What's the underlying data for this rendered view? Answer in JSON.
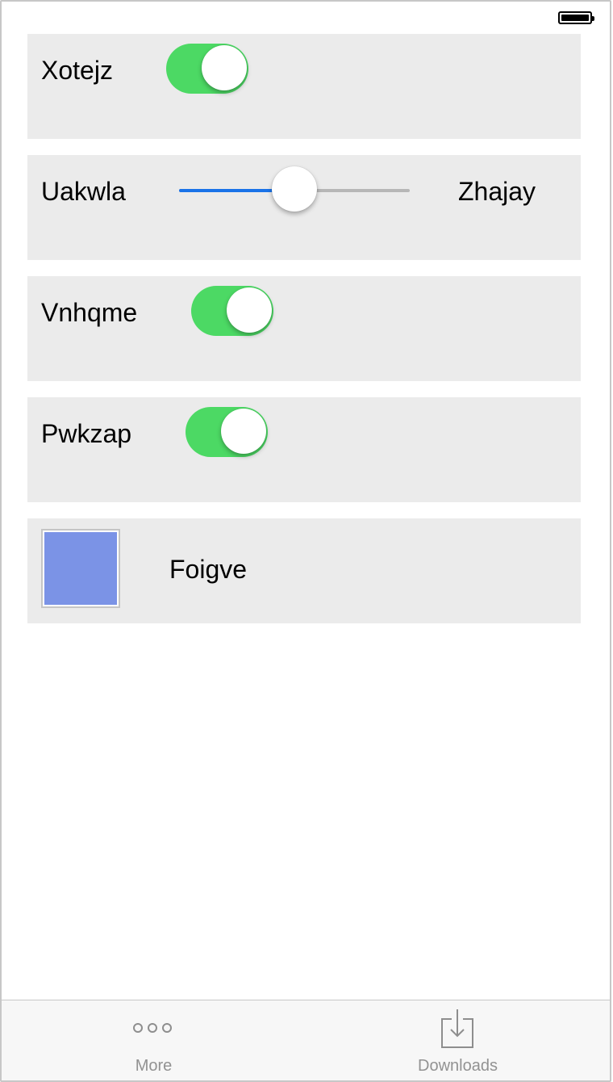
{
  "status_bar": {
    "battery_icon": "battery-full-icon"
  },
  "rows": [
    {
      "type": "toggle",
      "label": "Xotejz",
      "on": true
    },
    {
      "type": "slider",
      "left_label": "Uakwla",
      "right_label": "Zhajay",
      "value": 0.5
    },
    {
      "type": "toggle",
      "label": "Vnhqme",
      "on": true
    },
    {
      "type": "toggle",
      "label": "Pwkzap",
      "on": true
    },
    {
      "type": "color",
      "label": "Foigve",
      "color": "#7b93e6"
    }
  ],
  "tabbar": {
    "tabs": [
      {
        "label": "More",
        "icon": "more-dots-icon"
      },
      {
        "label": "Downloads",
        "icon": "downloads-icon"
      }
    ]
  },
  "colors": {
    "toggle_on": "#4cd964",
    "slider_fill": "#1a73e8",
    "cell_background": "#ebebeb",
    "tab_label": "#929292"
  }
}
